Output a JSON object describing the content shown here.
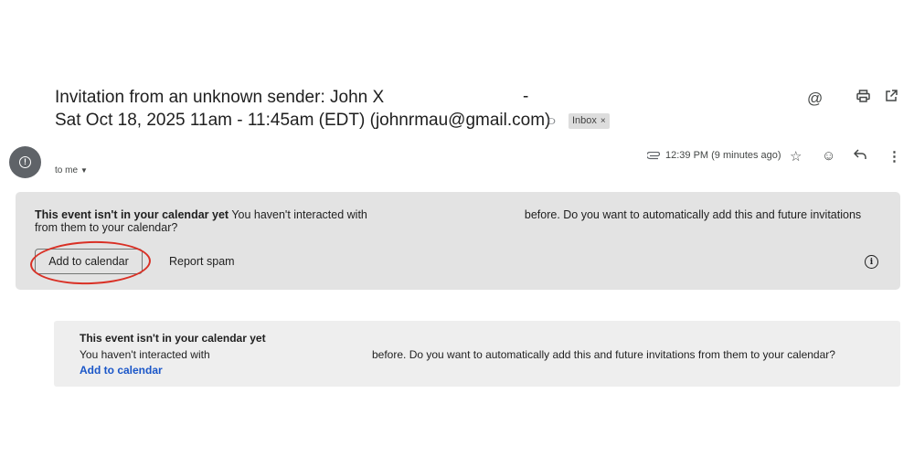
{
  "email": {
    "subject_line1": "Invitation from an unknown sender: John X",
    "subject_dash": "-",
    "subject_line2": "Sat Oct 18, 2025 11am - 11:45am (EDT) (johnrmau@gmail.com)",
    "label_chip": "Inbox",
    "label_remove": "×",
    "recipient": "to me",
    "attachment_icon": "paperclip-icon",
    "timestamp": "12:39 PM (9 minutes ago)"
  },
  "toolbar": {
    "icons": [
      "at-icon",
      "print-icon",
      "open-in-new-window-icon"
    ]
  },
  "message_actions": {
    "icons": [
      "star-icon",
      "emoji-icon",
      "reply-icon",
      "more-vert-icon"
    ]
  },
  "banner_primary": {
    "title": "This event isn't in your calendar yet",
    "text_before": "You haven't interacted with",
    "text_after": "before. Do you want to automatically add this and future invitations from them to your calendar?",
    "add_button": "Add to calendar",
    "spam_button": "Report spam",
    "info_icon": "info-icon",
    "annotation_color": "#d93025"
  },
  "banner_secondary": {
    "title": "This event isn't in your calendar yet",
    "text_before": "You haven't interacted with",
    "text_after": "before. Do you want to automatically add this and future invitations from them to your calendar?",
    "link": "Add to calendar",
    "link_color": "#1a56c8"
  }
}
